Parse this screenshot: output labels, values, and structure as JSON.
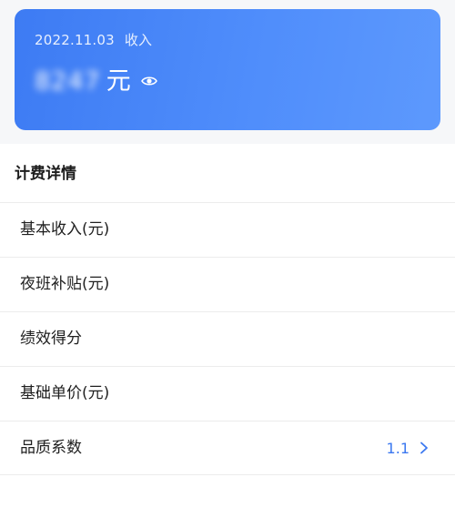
{
  "income_card": {
    "date": "2022.11.03",
    "label": "收入",
    "amount": "8247",
    "unit": "元"
  },
  "details": {
    "title": "计费详情",
    "rows": [
      {
        "label": "基本收入(元)",
        "value": ""
      },
      {
        "label": "夜班补贴(元)",
        "value": ""
      },
      {
        "label": "绩效得分",
        "value": ""
      },
      {
        "label": "基础单价(元)",
        "value": ""
      },
      {
        "label": "品质系数",
        "value": "1.1"
      }
    ]
  },
  "colors": {
    "card_gradient_start": "#3d7bf3",
    "card_gradient_end": "#5d99fd",
    "accent_value": "#3b78f0"
  },
  "icons": {
    "visibility": "eye-icon",
    "row_arrow": "chevron-right-icon"
  }
}
